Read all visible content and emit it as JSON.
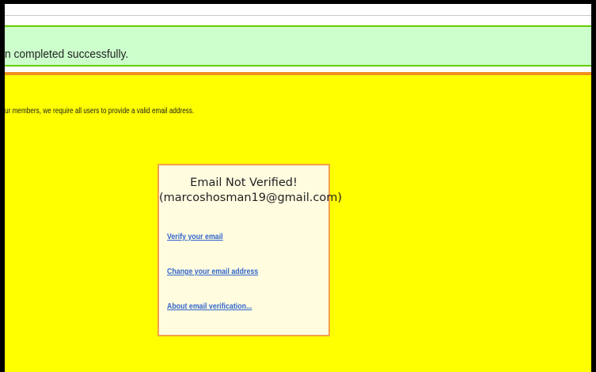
{
  "success_bar": {
    "message": "n completed successfully."
  },
  "info": {
    "text": "ur members, we require all users to provide a valid email address."
  },
  "verification_card": {
    "title": "Email Not Verified!",
    "email": "(marcoshosman19@gmail.com)",
    "links": [
      {
        "label": "Verify your email"
      },
      {
        "label": "Change your email address"
      },
      {
        "label": "About email verification..."
      }
    ]
  },
  "colors": {
    "success_background": "#ccffcc",
    "success_border": "#66cc00",
    "page_background": "#ffff00",
    "divider": "#f0901e",
    "card_border": "#f2a24a",
    "card_background": "#fffce0",
    "link": "#3366cc"
  }
}
